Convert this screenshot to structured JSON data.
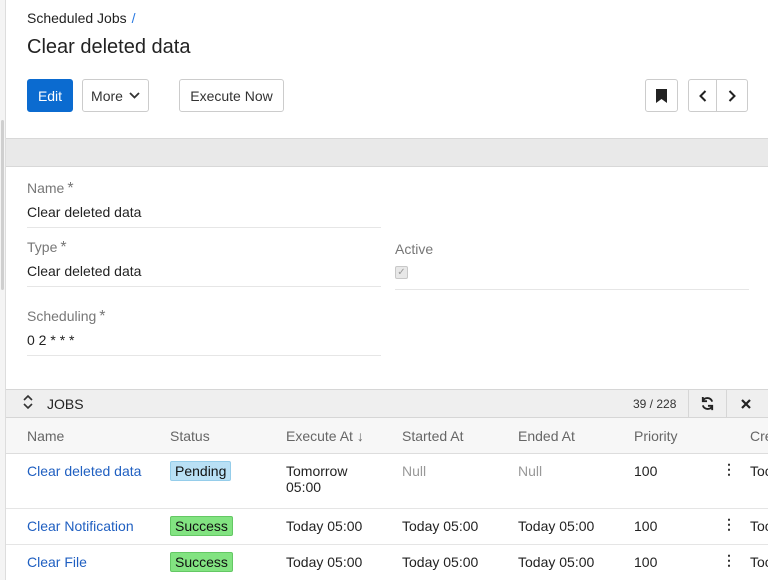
{
  "breadcrumb": {
    "label": "Scheduled Jobs",
    "separator": "/"
  },
  "title": "Clear deleted data",
  "toolbar": {
    "edit_label": "Edit",
    "more_label": "More",
    "execute_label": "Execute Now"
  },
  "form": {
    "name": {
      "label": "Name",
      "required": "*",
      "value": "Clear deleted data"
    },
    "type": {
      "label": "Type",
      "required": "*",
      "value": "Clear deleted data"
    },
    "active": {
      "label": "Active",
      "checked": true
    },
    "scheduling": {
      "label": "Scheduling",
      "required": "*",
      "value": "0 2 * * *"
    }
  },
  "jobs_panel": {
    "title": "JOBS",
    "count": "39 / 228",
    "columns": [
      "Name",
      "Status",
      "Execute At",
      "Started At",
      "Ended At",
      "Priority",
      "",
      "Cre"
    ],
    "sort_indicator": "↓",
    "rows": [
      {
        "name": "Clear deleted data",
        "status": "Pending",
        "execute_at": "Tomorrow",
        "execute_at_2": "05:00",
        "started_at": "Null",
        "ended_at": "Null",
        "priority": "100",
        "created": "Toc"
      },
      {
        "name": "Clear Notification",
        "status": "Success",
        "execute_at": "Today 05:00",
        "execute_at_2": "",
        "started_at": "Today 05:00",
        "ended_at": "Today 05:00",
        "priority": "100",
        "created": "Toc"
      },
      {
        "name": "Clear File",
        "status": "Success",
        "execute_at": "Today 05:00",
        "execute_at_2": "",
        "started_at": "Today 05:00",
        "ended_at": "Today 05:00",
        "priority": "100",
        "created": "Toc"
      }
    ]
  },
  "colors": {
    "primary": "#0b6bd0",
    "link": "#1f5fc1",
    "pending": "#b9e0f5",
    "success": "#82e381"
  },
  "icons": [
    "chevron-down-icon",
    "bookmark-icon",
    "chevron-left-icon",
    "chevron-right-icon",
    "expand-collapse-icon",
    "refresh-icon",
    "close-icon",
    "kebab-menu-icon",
    "checkmark-icon",
    "sort-down-icon"
  ]
}
